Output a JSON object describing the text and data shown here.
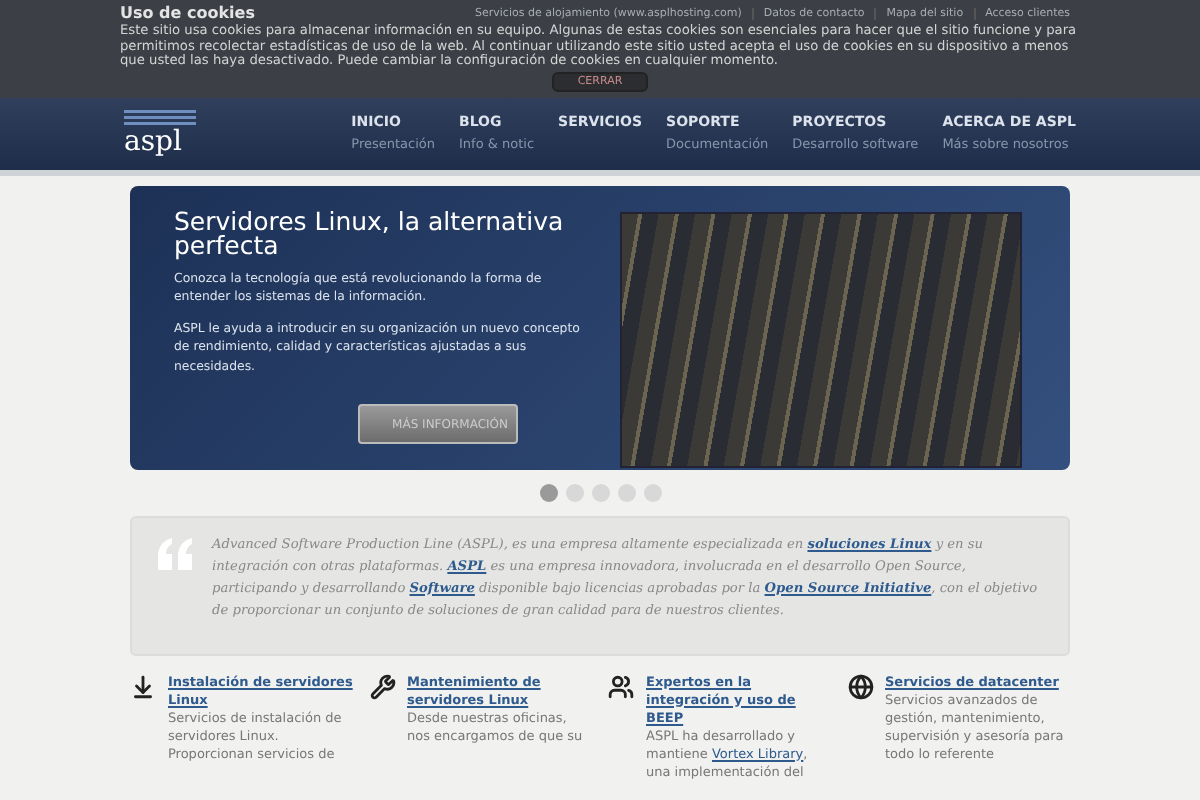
{
  "cookie_banner": {
    "title": "Uso de cookies",
    "text": "Este sitio usa cookies para almacenar información en su equipo. Algunas de estas cookies son esenciales para hacer que el sitio funcione y para permitimos recolectar estadísticas de uso de la web. Al continuar utilizando este sitio usted acepta el uso de cookies en su dispositivo a menos que usted las haya desactivado. Puede cambiar la configuración de cookies en cualquier momento.",
    "button": "CERRAR"
  },
  "top_links": [
    "Servicios de alojamiento (www.asplhosting.com)",
    "Datos de contacto",
    "Mapa del sitio",
    "Acceso clientes"
  ],
  "logo": "aspl",
  "nav": [
    {
      "label": "INICIO",
      "sub": "Presentación"
    },
    {
      "label": "BLOG",
      "sub": "Info & notic"
    },
    {
      "label": "SERVICIOS"
    },
    {
      "label": "SOPORTE",
      "sub": "Documentación"
    },
    {
      "label": "PROYECTOS",
      "sub": "Desarrollo software"
    },
    {
      "label": "ACERCA DE ASPL",
      "sub": "Más sobre nosotros"
    }
  ],
  "slider": {
    "title": "Servidores Linux, la alternativa perfecta",
    "paragraphs": [
      "Conozca la tecnología que está revolucionando la forma de entender los sistemas de la información.",
      "ASPL le ayuda a introducir en su organización un nuevo concepto de rendimiento, calidad y características ajustadas a sus necesidades."
    ],
    "button": "MÁS INFORMACIÓN",
    "dots": [
      {
        "selected": true
      },
      {
        "selected": false
      },
      {
        "selected": false
      },
      {
        "selected": false
      },
      {
        "selected": false
      }
    ]
  },
  "quote": [
    {
      "text": "Advanced Software Production Line (ASPL), es una empresa altamente especializada en ",
      "link": false
    },
    {
      "text": "soluciones Linux",
      "link": true
    },
    {
      "text": " y en su integración con otras plataformas. ",
      "link": false
    },
    {
      "text": "ASPL",
      "link": true
    },
    {
      "text": " es una empresa innovadora, involucrada en el desarrollo Open Source, participando y desarrollando ",
      "link": false
    },
    {
      "text": "Software",
      "link": true
    },
    {
      "text": " disponible bajo licencias aprobadas por la ",
      "link": false
    },
    {
      "text": "Open Source Initiative",
      "link": true
    },
    {
      "text": ", con el objetivo de proporcionar un conjunto de soluciones de gran calidad para de nuestros clientes.",
      "link": false
    }
  ],
  "features": [
    {
      "kind": "download",
      "title": "Instalación de servidores Linux",
      "text": [
        {
          "text": "Servicios de instalación de servidores Linux. Proporcionan servicios de",
          "link": false
        }
      ]
    },
    {
      "kind": "tools",
      "title": "Mantenimiento de servidores Linux",
      "text": [
        {
          "text": "Desde nuestras oficinas, nos encargamos de que su",
          "link": false
        }
      ]
    },
    {
      "kind": "people",
      "title": "Expertos en la integración y uso de BEEP",
      "text": [
        {
          "text": "ASPL ha desarrollado y mantiene ",
          "link": false
        },
        {
          "text": "Vortex Library",
          "link": true
        },
        {
          "text": ", una implementación del",
          "link": false
        }
      ]
    },
    {
      "kind": "globe",
      "title": "Servicios de datacenter",
      "text": [
        {
          "text": "Servicios avanzados de gestión, mantenimiento, supervisión y asesoría para todo lo referente",
          "link": false
        }
      ]
    }
  ]
}
